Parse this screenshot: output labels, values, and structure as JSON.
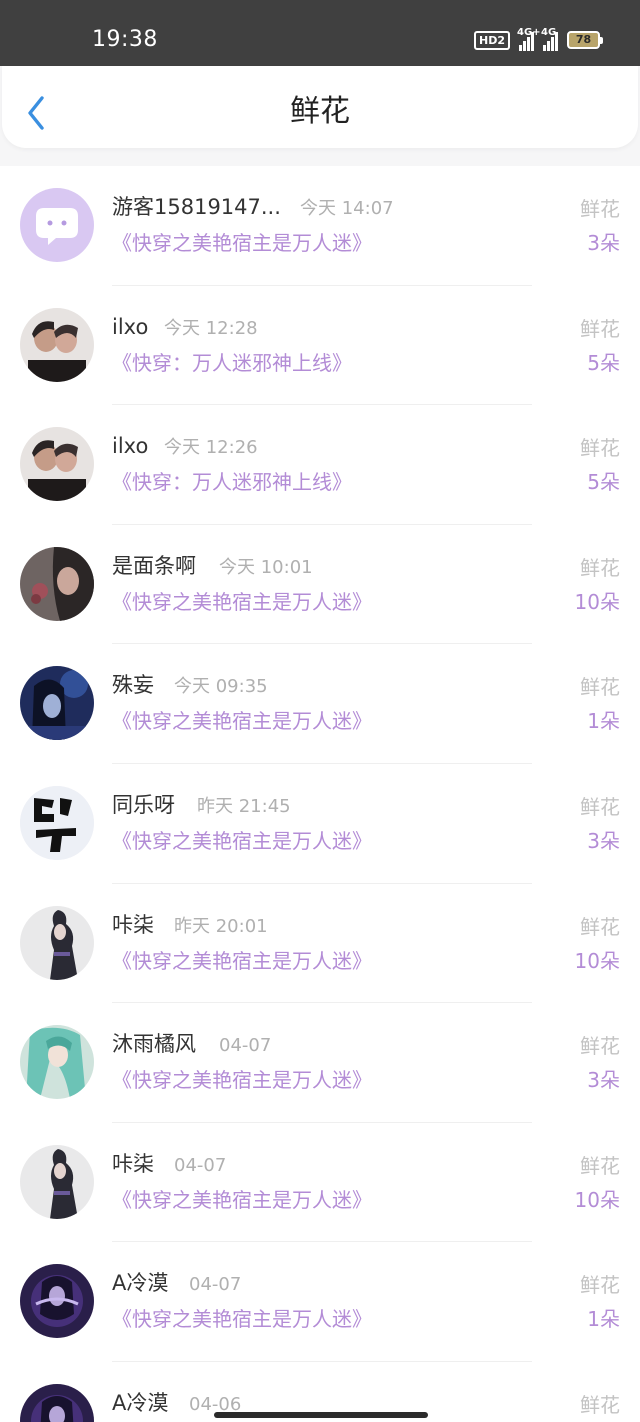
{
  "status_bar": {
    "time": "19:38",
    "hd_label": "HD2",
    "network_1": "4G+",
    "network_2": "4G",
    "battery": "78"
  },
  "header": {
    "title": "鲜花",
    "back_icon": "chevron-left-icon",
    "accent_color": "#3a8fe0"
  },
  "colors": {
    "book_title": "#b38cd6",
    "count": "#b38cd6",
    "gift_label": "#c3c3c3",
    "timestamp": "#b0b0b0"
  },
  "records": [
    {
      "name": "游客15819147...",
      "time": "今天 14:07",
      "book": "《快穿之美艳宿主是万人迷》",
      "gift": "鲜花",
      "count": "3朵"
    },
    {
      "name": "ilxo",
      "time": "今天 12:28",
      "book": "《快穿：万人迷邪神上线》",
      "gift": "鲜花",
      "count": "5朵"
    },
    {
      "name": "ilxo",
      "time": "今天 12:26",
      "book": "《快穿：万人迷邪神上线》",
      "gift": "鲜花",
      "count": "5朵"
    },
    {
      "name": "是面条啊",
      "time": "今天 10:01",
      "book": "《快穿之美艳宿主是万人迷》",
      "gift": "鲜花",
      "count": "10朵"
    },
    {
      "name": "殊妄",
      "time": "今天 09:35",
      "book": "《快穿之美艳宿主是万人迷》",
      "gift": "鲜花",
      "count": "1朵"
    },
    {
      "name": "同乐呀",
      "time": "昨天 21:45",
      "book": "《快穿之美艳宿主是万人迷》",
      "gift": "鲜花",
      "count": "3朵"
    },
    {
      "name": "咔柒",
      "time": "昨天 20:01",
      "book": "《快穿之美艳宿主是万人迷》",
      "gift": "鲜花",
      "count": "10朵"
    },
    {
      "name": "沐雨橘风",
      "time": "04-07",
      "book": "《快穿之美艳宿主是万人迷》",
      "gift": "鲜花",
      "count": "3朵"
    },
    {
      "name": "咔柒",
      "time": "04-07",
      "book": "《快穿之美艳宿主是万人迷》",
      "gift": "鲜花",
      "count": "10朵"
    },
    {
      "name": "A冷漠",
      "time": "04-07",
      "book": "《快穿之美艳宿主是万人迷》",
      "gift": "鲜花",
      "count": "1朵"
    },
    {
      "name": "A冷漠",
      "time": "04-06",
      "book": "",
      "gift": "鲜花",
      "count": ""
    }
  ]
}
